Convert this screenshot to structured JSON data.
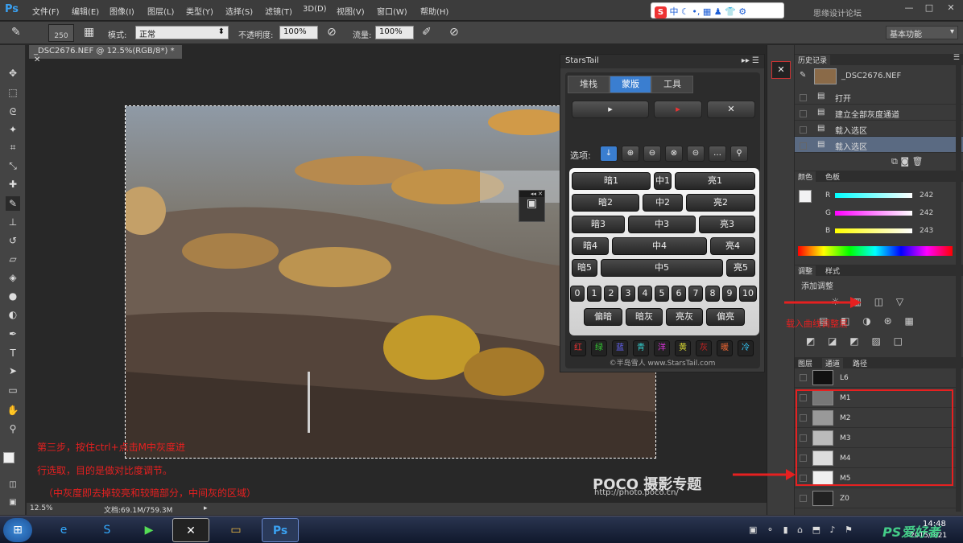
{
  "app": {
    "logo": "Ps",
    "menus": [
      "文件(F)",
      "编辑(E)",
      "图像(I)",
      "图层(L)",
      "类型(Y)",
      "选择(S)",
      "滤镜(T)",
      "3D(D)",
      "视图(V)",
      "窗口(W)",
      "帮助(H)"
    ],
    "ime_label": "中",
    "watermark_top": "思缘设计论坛"
  },
  "options": {
    "brush_size": "250",
    "mode_label": "模式:",
    "mode_value": "正常",
    "opacity_label": "不透明度:",
    "opacity_value": "100%",
    "flow_label": "流量:",
    "flow_value": "100%",
    "workspace": "基本功能"
  },
  "document": {
    "tab_title": "_DSC2676.NEF @ 12.5%(RGB/8*) *"
  },
  "annotations": {
    "step_line1": "第三步，按住ctrl+点击M中灰度进",
    "step_line2": "行选取，目的是做对比度调节。",
    "step_line3": "（中灰度即去掉较亮和较暗部分，中间灰的区域）",
    "poco_logo": "POCO 摄影专题",
    "poco_url": "http://photo.poco.cn/",
    "curves_label": "载入曲线调整层"
  },
  "startail": {
    "title": "StarsTail",
    "tabs": [
      "堆栈",
      "蒙版",
      "工具"
    ],
    "options_label": "选项:",
    "rows": [
      [
        "暗1",
        "中1",
        "亮1"
      ],
      [
        "暗2",
        "中2",
        "亮2"
      ],
      [
        "暗3",
        "中3",
        "亮3"
      ],
      [
        "暗4",
        "中4",
        "亮4"
      ],
      [
        "暗5",
        "中5",
        "亮5"
      ]
    ],
    "numbers": [
      "0",
      "1",
      "2",
      "3",
      "4",
      "5",
      "6",
      "7",
      "8",
      "9",
      "10"
    ],
    "bottom": [
      "偏暗",
      "暗灰",
      "亮灰",
      "偏亮"
    ],
    "colors": [
      "红",
      "绿",
      "蓝",
      "青",
      "洋",
      "黄",
      "灰",
      "暖",
      "冷"
    ],
    "footer": "©半岛雪人 www.StarsTail.com"
  },
  "history": {
    "tabs": [
      "历史记录"
    ],
    "snapshot": "_DSC2676.NEF",
    "items": [
      "打开",
      "建立全部灰度通道",
      "载入选区",
      "载入选区"
    ]
  },
  "color": {
    "tabs": [
      "颜色",
      "色板"
    ],
    "channels": [
      {
        "name": "R",
        "value": "242"
      },
      {
        "name": "G",
        "value": "242"
      },
      {
        "name": "B",
        "value": "243"
      }
    ]
  },
  "adjust": {
    "tabs": [
      "调整",
      "样式"
    ],
    "title": "添加调整"
  },
  "channels": {
    "tabs": [
      "图层",
      "通道",
      "路径"
    ],
    "rows": [
      "L6",
      "M1",
      "M2",
      "M3",
      "M4",
      "M5",
      "Z0"
    ]
  },
  "status": {
    "zoom": "12.5%",
    "doc": "文档:69.1M/759.3M"
  },
  "taskbar": {
    "time": "14:48",
    "date": "2015/9/21",
    "watermark": "PS爱好者"
  },
  "colors": {
    "accent": "#3aa0f0",
    "highlight": "#e62020",
    "ui_bg": "#3a3a3a"
  }
}
